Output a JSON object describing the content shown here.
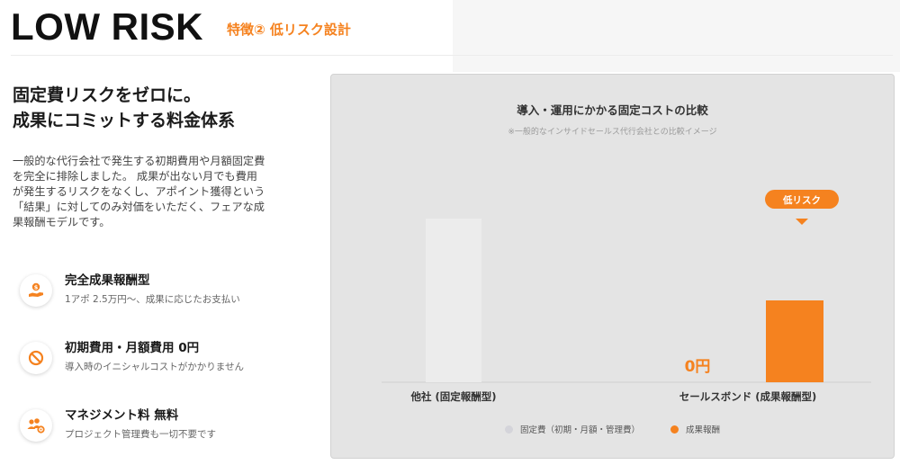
{
  "header": {
    "title": "LOW RISK",
    "tag": "特徴② 低リスク設計"
  },
  "intro": {
    "headline_line1": "固定費リスクをゼロに。",
    "headline_line2": "成果にコミットする料金体系",
    "description_lines": [
      "一般的な代行会社で発生する初期費用や月額固定費",
      "を完全に排除しました。 成果が出ない月でも費用",
      "が発生するリスクをなくし、アポイント獲得という",
      "「結果」に対してのみ対価をいただく、フェアな成",
      "果報酬モデルです。"
    ]
  },
  "features": [
    {
      "icon": "hand-coin-icon",
      "title": "完全成果報酬型",
      "sub": "1アポ 2.5万円〜、成果に応じたお支払い"
    },
    {
      "icon": "prohibited-icon",
      "title": "初期費用・月額費用 0円",
      "sub": "導入時のイニシャルコストがかかりません"
    },
    {
      "icon": "team-gear-icon",
      "title": "マネジメント料 無料",
      "sub": "プロジェクト管理費も一切不要です"
    }
  ],
  "colors": {
    "accent": "#f5821f",
    "fixed_bar": "#ececec"
  },
  "chart_data": {
    "type": "bar",
    "title": "導入・運用にかかる固定コストの比較",
    "subtitle": "※一般的なインサイドセールス代行会社との比較イメージ",
    "categories": [
      "他社 (固定報酬型)",
      "セールスボンド (成果報酬型)"
    ],
    "series": [
      {
        "name": "固定費（初期・月額・管理費）",
        "values": [
          100,
          0
        ]
      },
      {
        "name": "成果報酬",
        "values": [
          0,
          50
        ]
      }
    ],
    "annotations": {
      "zero_label": "0円",
      "badge": "低リスク"
    },
    "ylim": [
      0,
      100
    ],
    "grid": false,
    "legend": "bottom-center"
  }
}
